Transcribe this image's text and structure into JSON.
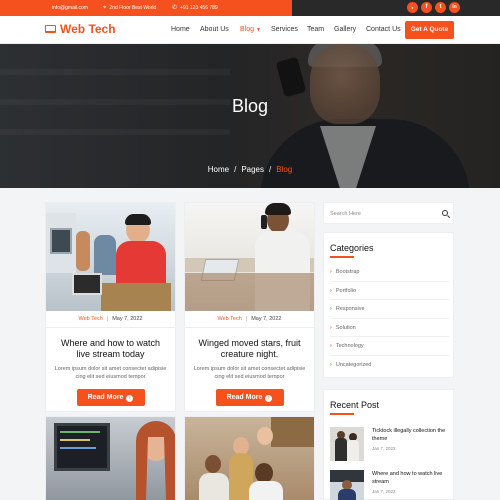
{
  "topbar": {
    "email": "info@gmail.com",
    "address": "2nd Floor Best World",
    "phone": "+91 123 456 789",
    "socials": [
      {
        "icon": "rss-icon",
        "glyph": "●"
      },
      {
        "icon": "facebook-icon",
        "glyph": "f"
      },
      {
        "icon": "twitter-icon",
        "glyph": "t"
      },
      {
        "icon": "linkedin-icon",
        "glyph": "in"
      }
    ]
  },
  "nav": {
    "brand": "Web Tech",
    "items": [
      "Home",
      "About Us",
      "Blog",
      "Services",
      "Team",
      "Gallery",
      "Contact Us"
    ],
    "active": "Blog",
    "quote_button": "Get A Quote"
  },
  "hero": {
    "title": "Blog",
    "breadcrumb": [
      "Home",
      "Pages",
      "Blog"
    ]
  },
  "posts": [
    {
      "category": "Web Tech",
      "date": "May 7, 2022",
      "title": "Where and how to watch live stream today",
      "excerpt": "Lorem ipsum dolor sit amet consectet adipisie cing elit sed eiusmod tempor",
      "button": "Read More"
    },
    {
      "category": "Web Tech",
      "date": "May 7, 2022",
      "title": "Winged moved stars, fruit creature night.",
      "excerpt": "Lorem ipsum dolor sit amet consectet adipisie cing elit sed eiusmod tempor",
      "button": "Read More"
    }
  ],
  "sidebar": {
    "search_placeholder": "Search Here",
    "categories_title": "Categories",
    "categories": [
      "Bootstrap",
      "Portfolio",
      "Responsive",
      "Solution",
      "Technology",
      "Uncategorized"
    ],
    "recent_title": "Recent Post",
    "recent": [
      {
        "title": "Ticktock illegally collection the theme",
        "date": "Jan 7, 2022"
      },
      {
        "title": "Where and how to watch live stream",
        "date": "Jan 7, 2022"
      }
    ]
  },
  "colors": {
    "accent": "#f4511e",
    "topbar_dark": "#292929"
  }
}
